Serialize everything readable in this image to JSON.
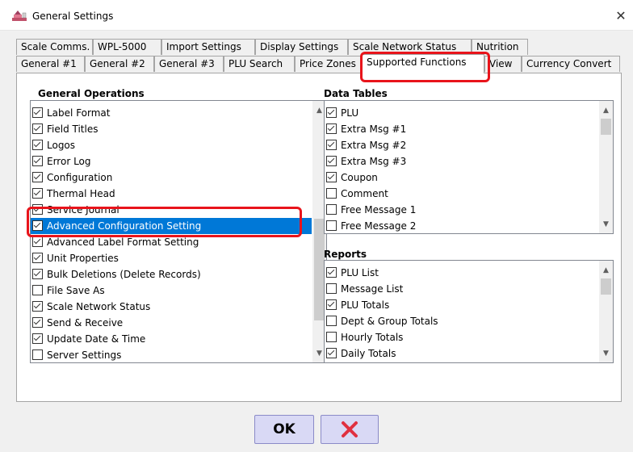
{
  "window": {
    "title": "General Settings",
    "app_icon": "scale-icon",
    "close_icon": "close-icon",
    "close_glyph": "✕"
  },
  "tabs_row1": [
    "Scale Comms.",
    "WPL-5000",
    "Import Settings",
    "Display Settings",
    "Scale Network Status",
    "Nutrition"
  ],
  "tabs_row2": [
    "General #1",
    "General #2",
    "General #3",
    "PLU Search",
    "Price Zones",
    "Supported Functions",
    "View",
    "Currency Convert"
  ],
  "active_tab": "Supported Functions",
  "general_operations": {
    "label": "General Operations",
    "items": [
      {
        "label": "Label Format",
        "checked": true
      },
      {
        "label": "Field Titles",
        "checked": true
      },
      {
        "label": "Logos",
        "checked": true
      },
      {
        "label": "Error Log",
        "checked": true
      },
      {
        "label": "Configuration",
        "checked": true
      },
      {
        "label": "Thermal Head",
        "checked": true
      },
      {
        "label": "Service Journal",
        "checked": true
      },
      {
        "label": "Advanced Configuration Setting",
        "checked": true,
        "selected": true
      },
      {
        "label": "Advanced Label Format Setting",
        "checked": true
      },
      {
        "label": "Unit Properties",
        "checked": true
      },
      {
        "label": "Bulk Deletions (Delete Records)",
        "checked": true
      },
      {
        "label": "File Save As",
        "checked": false
      },
      {
        "label": "Scale Network Status",
        "checked": true
      },
      {
        "label": "Send & Receive",
        "checked": true
      },
      {
        "label": "Update Date & Time",
        "checked": true
      },
      {
        "label": "Server Settings",
        "checked": false
      }
    ]
  },
  "data_tables": {
    "label": "Data Tables",
    "items": [
      {
        "label": "PLU",
        "checked": true
      },
      {
        "label": "Extra Msg #1",
        "checked": true
      },
      {
        "label": "Extra Msg #2",
        "checked": true
      },
      {
        "label": "Extra Msg #3",
        "checked": true
      },
      {
        "label": "Coupon",
        "checked": true
      },
      {
        "label": "Comment",
        "checked": false
      },
      {
        "label": "Free Message 1",
        "checked": false
      },
      {
        "label": "Free Message 2",
        "checked": false
      }
    ]
  },
  "reports": {
    "label": "Reports",
    "items": [
      {
        "label": "PLU List",
        "checked": true
      },
      {
        "label": "Message List",
        "checked": false
      },
      {
        "label": "PLU Totals",
        "checked": true
      },
      {
        "label": "Dept & Group Totals",
        "checked": false
      },
      {
        "label": "Hourly Totals",
        "checked": false
      },
      {
        "label": "Daily Totals",
        "checked": true
      }
    ]
  },
  "scroll_arrows": {
    "up": "▲",
    "down": "▼"
  },
  "buttons": {
    "ok_label": "OK",
    "cancel_glyph": "✕"
  },
  "colors": {
    "selection": "#0078d7",
    "highlight": "#e8141b",
    "cancel_x": "#e03040",
    "button_bg": "#d9d9f5"
  }
}
